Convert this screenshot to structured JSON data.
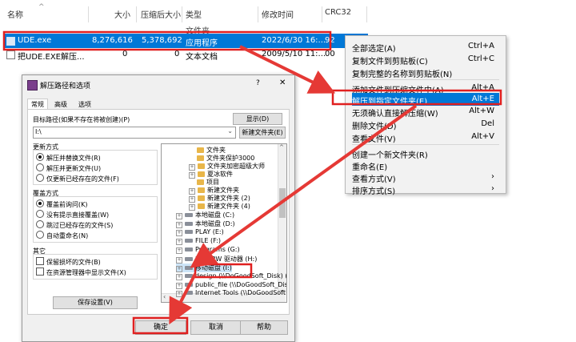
{
  "columns": [
    "名称",
    "大小",
    "压缩后大小",
    "类型",
    "修改时间",
    "CRC32"
  ],
  "sort_arrow": "^",
  "partial_row_type": "文件夹",
  "files": [
    {
      "name": "UDE.exe",
      "size": "8,276,616",
      "packed": "5,378,692",
      "type": "应用程序",
      "modified": "2022/6/30 16:...",
      "crc": "92"
    },
    {
      "name": "把UDE.EXE解压...",
      "size": "0",
      "packed": "0",
      "type": "文本文档",
      "modified": "2009/5/10 11:...",
      "crc": "00"
    }
  ],
  "context_menu": {
    "items": [
      {
        "label": "全部选定(A)",
        "shortcut": "Ctrl+A"
      },
      {
        "label": "复制文件到剪贴板(C)",
        "shortcut": "Ctrl+C"
      },
      {
        "label": "复制完整的名称到剪贴板(N)",
        "shortcut": ""
      },
      {
        "label": "添加文件到压缩文件中(A)",
        "shortcut": "Alt+A"
      },
      {
        "label": "解压到指定文件夹(E)",
        "shortcut": "Alt+E"
      },
      {
        "label": "无须确认直接解压缩(W)",
        "shortcut": "Alt+W"
      },
      {
        "label": "删除文件(D)",
        "shortcut": "Del"
      },
      {
        "label": "查看文件(V)",
        "shortcut": "Alt+V"
      },
      {
        "label": "创建一个新文件夹(R)",
        "shortcut": ""
      },
      {
        "label": "重命名(E)",
        "shortcut": ""
      },
      {
        "label": "查看方式(V)",
        "shortcut": "›"
      },
      {
        "label": "排序方式(S)",
        "shortcut": "›"
      }
    ]
  },
  "dialog": {
    "title": "解压路径和选项",
    "help_glyph": "?",
    "close_glyph": "✕",
    "tabs": [
      "常规",
      "高级",
      "选项"
    ],
    "path_label": "目标路径(如果不存在将被创建)(P)",
    "path_value": "I:\\",
    "show_button": "显示(D)",
    "new_folder_button": "新建文件夹(E)",
    "update_group": "更新方式",
    "update_options": [
      "解压并替换文件(R)",
      "解压并更新文件(U)",
      "仅更新已经存在的文件(F)"
    ],
    "overwrite_group": "覆盖方式",
    "overwrite_options": [
      "覆盖前询问(K)",
      "没有提示直接覆盖(W)",
      "跳过已经存在的文件(S)",
      "自动重命名(N)"
    ],
    "misc_group": "其它",
    "misc_options": [
      "保留损坏的文件(B)",
      "在资源管理器中显示文件(X)"
    ],
    "save_settings": "保存设置(V)",
    "ok": "确定",
    "cancel": "取消",
    "help": "帮助",
    "tree": [
      "文件夹",
      "文件夹保护3000",
      "文件夹加密超级大师",
      "夏冰软件",
      "项目",
      "新建文件夹",
      "新建文件夹 (2)",
      "新建文件夹 (4)",
      "本地磁盘 (C:)",
      "本地磁盘 (D:)",
      "PLAY (E:)",
      "FILE (F:)",
      "Programs (G:)",
      "DVD RW 驱动器 (H:)",
      "移动磁盘 (I:)",
      "design (\\\\DoGoodSoft_Disk) (W:)",
      "public_file (\\\\DoGoodSoft_Disk) (",
      "Internet Tools (\\\\DoGoodSoft"
    ]
  },
  "colors": {
    "selection": "#0078d7",
    "highlight_box": "#e02020",
    "arrow": "#e53935"
  }
}
